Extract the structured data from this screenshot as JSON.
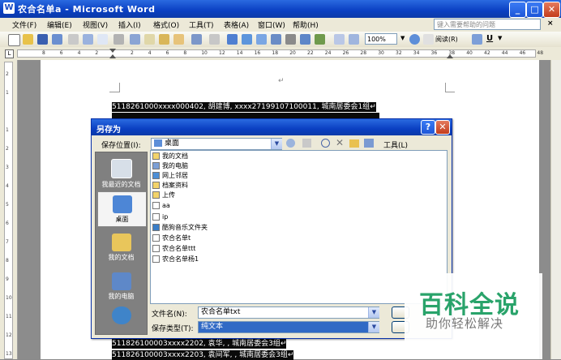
{
  "window": {
    "title": "农合名单a - Microsoft Word",
    "app_icon": "W",
    "minimize": "_",
    "maximize": "□",
    "close": "✕"
  },
  "menu": {
    "items": [
      "文件(F)",
      "编辑(E)",
      "视图(V)",
      "插入(I)",
      "格式(O)",
      "工具(T)",
      "表格(A)",
      "窗口(W)",
      "帮助(H)"
    ],
    "help_search_placeholder": "键入需要帮助的问题",
    "help_close": "×"
  },
  "toolbar": {
    "zoom": "100%",
    "reading_label": "阅读(R)",
    "underline_label": "U"
  },
  "ruler": {
    "numbers": [
      "8",
      "6",
      "4",
      "2",
      "",
      "2",
      "4",
      "6",
      "8",
      "10",
      "12",
      "14",
      "16",
      "18",
      "20",
      "22",
      "24",
      "26",
      "28",
      "30",
      "32",
      "34",
      "36",
      "38",
      "40",
      "42",
      "44",
      "46",
      "48"
    ],
    "left_numbers": [
      "2",
      "1",
      "",
      "1",
      "2",
      "3",
      "4",
      "5",
      "6",
      "7",
      "8",
      "9",
      "10",
      "11",
      "12",
      "13"
    ]
  },
  "document": {
    "paragraph_mark": "↵",
    "line1": "5118261000xxxx000402,  胡建博, xxxx27199107100011,  城南居委会1组↵",
    "line2": "511826100003xxxx2202,  袁华, , 城南居委会3组↵",
    "line3": "511826100003xxxx2203,  袁间军, , 城南居委会3组↵"
  },
  "dialog": {
    "title": "另存为",
    "help_button": "?",
    "close_button": "✕",
    "save_in_label": "保存位置(I):",
    "save_in_value": "桌面",
    "tools_label": "工具(L)",
    "places": [
      {
        "label": "我最近的文档",
        "icon": "recent-documents-icon"
      },
      {
        "label": "桌面",
        "icon": "desktop-icon"
      },
      {
        "label": "我的文档",
        "icon": "my-documents-icon"
      },
      {
        "label": "我的电脑",
        "icon": "my-computer-icon"
      },
      {
        "label": "",
        "icon": "network-places-icon"
      }
    ],
    "files": [
      {
        "name": "我的文档",
        "icon": "folder-icon"
      },
      {
        "name": "我的电脑",
        "icon": "computer-icon"
      },
      {
        "name": "网上邻居",
        "icon": "network-icon"
      },
      {
        "name": "档案资料",
        "icon": "folder-icon"
      },
      {
        "name": "上传",
        "icon": "folder-icon"
      },
      {
        "name": "aa",
        "icon": "text-file-icon"
      },
      {
        "name": "ip",
        "icon": "text-file-icon"
      },
      {
        "name": "酷狗音乐文件夹",
        "icon": "shortcut-icon"
      },
      {
        "name": "农合名单t",
        "icon": "text-file-icon"
      },
      {
        "name": "农合名单ttt",
        "icon": "text-file-icon"
      },
      {
        "name": "农合名单杨1",
        "icon": "text-file-icon"
      }
    ],
    "filename_label": "文件名(N):",
    "filename_value": "农合名单txt",
    "filetype_label": "保存类型(T):",
    "filetype_value": "纯文本"
  },
  "watermark": {
    "title": "百科全说",
    "subtitle": "助你轻松解决"
  },
  "colors": {
    "titlebar": "#0a3fc2",
    "watermark_green": "#29a36a"
  }
}
